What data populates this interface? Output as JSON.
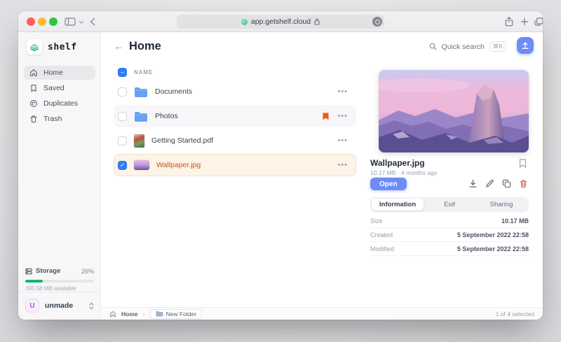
{
  "browser": {
    "url": "app.getshelf.cloud"
  },
  "sidebar": {
    "logo": "shelf",
    "nav": [
      {
        "label": "Home"
      },
      {
        "label": "Saved"
      },
      {
        "label": "Duplicates"
      },
      {
        "label": "Trash"
      }
    ],
    "storage": {
      "label": "Storage",
      "percent": "26%",
      "available": "395.58 MB available"
    },
    "user": {
      "initial": "U",
      "name": "unmade"
    }
  },
  "header": {
    "title": "Home",
    "search": {
      "label": "Quick search",
      "shortcut": "⌘K"
    }
  },
  "list": {
    "column_name": "NAME",
    "rows": [
      {
        "name": "Documents"
      },
      {
        "name": "Photos"
      },
      {
        "name": "Getting Started.pdf"
      },
      {
        "name": "Wallpaper.jpg"
      }
    ]
  },
  "details": {
    "name": "Wallpaper.jpg",
    "meta": "10.17 MB · 4 months ago",
    "open_label": "Open",
    "tabs": [
      {
        "label": "Information"
      },
      {
        "label": "Exif"
      },
      {
        "label": "Sharing"
      }
    ],
    "info": [
      {
        "label": "Size",
        "value": "10.17 MB"
      },
      {
        "label": "Created",
        "value": "5 September 2022 22:58"
      },
      {
        "label": "Modified",
        "value": "5 September 2022 22:58"
      }
    ]
  },
  "footer": {
    "home": "Home",
    "new_folder": "New Folder",
    "selection": "1 of 4 selected"
  },
  "glyphs": {
    "back": "←",
    "ellipsis": "•••",
    "check": "✓",
    "minus": "–",
    "crumb_sep": "›"
  },
  "colors": {
    "accent_blue": "#6e8bf7",
    "checkbox_blue": "#2f7df6",
    "folder_blue": "#69a1f4",
    "bookmark_orange": "#ee5b0c",
    "storage_green": "#12b76a",
    "selected_row_bg": "#fdf3e6",
    "selected_row_text": "#c2571b",
    "danger_red": "#e06363"
  }
}
